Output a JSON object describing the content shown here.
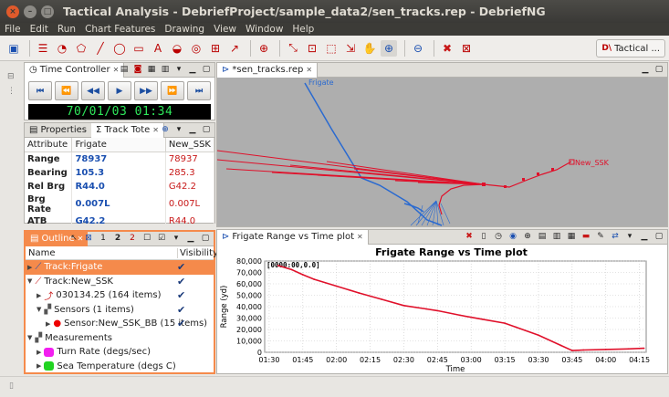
{
  "window": {
    "title": "Tactical Analysis - DebriefProject/sample_data2/sen_tracks.rep - DebriefNG"
  },
  "menu": [
    "File",
    "Edit",
    "Run",
    "Chart Features",
    "Drawing",
    "View",
    "Window",
    "Help"
  ],
  "perspective": {
    "logo": "D\\",
    "label": "Tactical ..."
  },
  "time_controller": {
    "tabs": [
      "Time Controller"
    ],
    "clock": "70/01/03 01:34",
    "buttons": [
      "first",
      "back-large",
      "back-small",
      "play",
      "fwd-small",
      "fwd-large",
      "last"
    ]
  },
  "tote": {
    "tabs": [
      "Properties",
      "Track Tote"
    ],
    "headers": [
      "Attribute",
      "Frigate",
      "New_SSK"
    ],
    "rows": [
      {
        "attr": "Range",
        "frigate": "78937",
        "ssk": "78937"
      },
      {
        "attr": "Bearing",
        "frigate": "105.3",
        "ssk": "285.3"
      },
      {
        "attr": "Rel Brg",
        "frigate": "R44.0",
        "ssk": "G42.2"
      },
      {
        "attr": "Brg Rate",
        "frigate": "0.007L",
        "ssk": "0.007L"
      },
      {
        "attr": "ATB",
        "frigate": "G42.2",
        "ssk": "R44.0"
      }
    ]
  },
  "outline": {
    "tab": "Outline",
    "headers": [
      "Name",
      "Visibility"
    ],
    "items": [
      {
        "label": "Track:Frigate",
        "level": 0,
        "visible": "✔",
        "selected": true
      },
      {
        "label": "Track:New_SSK",
        "level": 0,
        "visible": "✔",
        "selected": false
      },
      {
        "label": "030134.25 (164 items)",
        "level": 1,
        "visible": "✔",
        "selected": false
      },
      {
        "label": "Sensors (1 items)",
        "level": 1,
        "visible": "✔",
        "selected": false
      },
      {
        "label": "Sensor:New_SSK_BB (15 items)",
        "level": 2,
        "visible": "✔",
        "selected": false
      },
      {
        "label": "Measurements",
        "level": 0,
        "visible": "",
        "selected": false
      },
      {
        "label": "Turn Rate (degs/sec)",
        "level": 1,
        "visible": "",
        "selected": false
      },
      {
        "label": "Sea Temperature (degs C)",
        "level": 1,
        "visible": "",
        "selected": false
      }
    ],
    "toolbar_text": [
      "1",
      "2",
      "2"
    ]
  },
  "editor": {
    "tab": "*sen_tracks.rep",
    "labels": {
      "frigate": "Frigate",
      "ssk": "New_SSK"
    }
  },
  "plot_view": {
    "tab": "Frigate Range vs Time plot"
  },
  "chart_data": {
    "type": "line",
    "title": "Frigate Range vs Time plot",
    "xlabel": "Time",
    "ylabel": "Range (yd)",
    "annotation": "[0000:00,0.0]",
    "x_ticks": [
      "01:30",
      "01:45",
      "02:00",
      "02:15",
      "02:30",
      "02:45",
      "03:00",
      "03:15",
      "03:30",
      "03:45",
      "04:00",
      "04:15"
    ],
    "y_ticks": [
      "0",
      "10,000",
      "20,000",
      "30,000",
      "40,000",
      "50,000",
      "60,000",
      "70,000",
      "80,000"
    ],
    "ylim": [
      0,
      80000
    ],
    "grid": true,
    "series": [
      {
        "color": "#e0102a",
        "x": [
          "01:34",
          "01:40",
          "01:45",
          "01:50",
          "02:00",
          "02:10",
          "02:20",
          "02:30",
          "02:40",
          "02:45",
          "02:55",
          "03:05",
          "03:15",
          "03:20",
          "03:30",
          "03:40",
          "03:45",
          "03:50",
          "04:00",
          "04:10",
          "04:17"
        ],
        "values": [
          76000,
          72500,
          68000,
          64000,
          58000,
          52000,
          46500,
          41000,
          38000,
          36500,
          32500,
          29000,
          25500,
          22000,
          15000,
          6000,
          1500,
          2000,
          2500,
          3000,
          3500
        ]
      }
    ]
  },
  "colors": {
    "accent": "#f58a4b",
    "track_red": "#e0102a",
    "track_blue": "#2a6ad0"
  }
}
